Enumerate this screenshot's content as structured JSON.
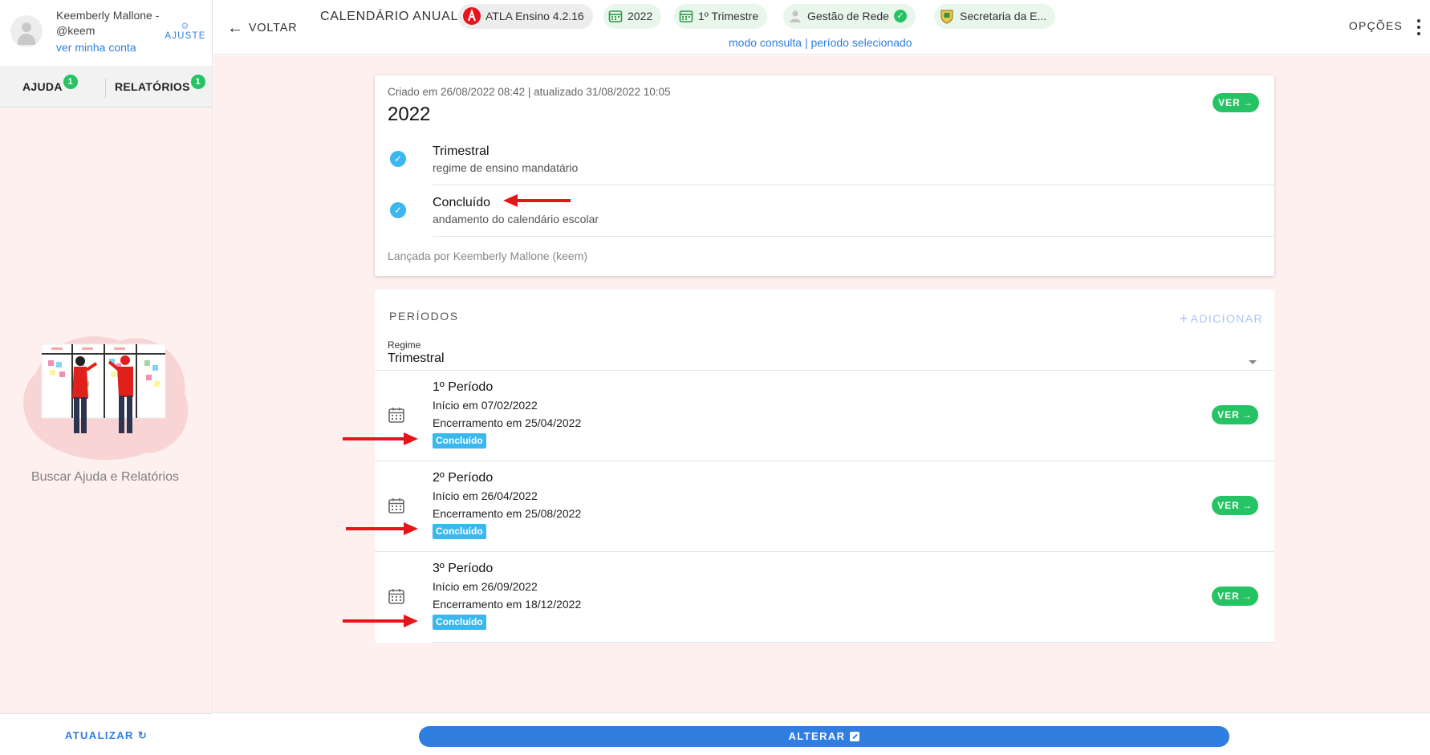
{
  "user": {
    "name": "Keemberly Mallone - @keem",
    "account_link": "ver minha conta",
    "settings_label": "AJUSTE"
  },
  "help_tabs": [
    {
      "label": "AJUDA",
      "badge": "1"
    },
    {
      "label": "RELATÓRIOS",
      "badge": "1"
    }
  ],
  "sidebar": {
    "search_help": "Buscar Ajuda e Relatórios",
    "refresh_label": "ATUALIZAR"
  },
  "header": {
    "back_label": "VOLTAR",
    "title": "CALENDÁRIO ANUAL",
    "chips": [
      {
        "label": "ATLA Ensino 4.2.16",
        "icon": "atla-logo-icon"
      },
      {
        "label": "2022",
        "icon": "calendar-icon"
      },
      {
        "label": "1º Trimestre",
        "icon": "calendar-icon"
      },
      {
        "label": "Gestão de Rede",
        "icon": "user-icon",
        "status": "ok"
      },
      {
        "label": "Secretaria da E...",
        "icon": "crest-icon"
      }
    ],
    "mode_text": "modo consulta | período selecionado",
    "options_label": "OPÇÕES"
  },
  "calendar_card": {
    "meta": "Criado em 26/08/2022 08:42 | atualizado 31/08/2022 10:05",
    "year": "2022",
    "view_label": "VER",
    "checks": [
      {
        "title": "Trimestral",
        "subtitle": "regime de ensino mandatário"
      },
      {
        "title": "Concluído",
        "subtitle": "andamento do calendário escolar"
      }
    ],
    "launched_by": "Lançada por Keemberly Mallone (keem)"
  },
  "periods": {
    "title": "PERÍODOS",
    "add_label": "ADICIONAR",
    "regime_label": "Regime",
    "regime_value": "Trimestral",
    "items": [
      {
        "name": "1º Período",
        "start": "Início em 07/02/2022",
        "end": "Encerramento em 25/04/2022",
        "status": "Concluído",
        "view_label": "VER"
      },
      {
        "name": "2º Período",
        "start": "Início em 26/04/2022",
        "end": "Encerramento em 25/08/2022",
        "status": "Concluído",
        "view_label": "VER"
      },
      {
        "name": "3º Período",
        "start": "Início em 26/09/2022",
        "end": "Encerramento em 18/12/2022",
        "status": "Concluído",
        "view_label": "VER"
      }
    ]
  },
  "footer": {
    "alter_label": "ALTERAR"
  },
  "colors": {
    "accent_blue": "#2f7fe0",
    "success_green": "#25c363",
    "status_cyan": "#3ab7ef",
    "annotation_red": "#e8141b",
    "background_pink": "#fdf0ef"
  }
}
